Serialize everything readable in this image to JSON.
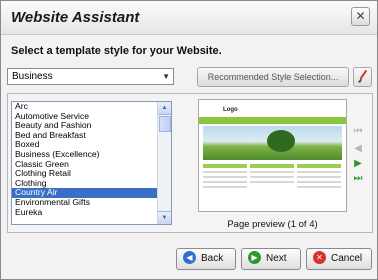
{
  "window": {
    "title": "Website Assistant",
    "close_glyph": "✕"
  },
  "heading": "Select a template style for your Website.",
  "category_select": {
    "value": "Business",
    "arrow": "▼"
  },
  "recommended_button": {
    "label": "Recommended Style Selection..."
  },
  "brush_button": {
    "icon": "paintbrush-icon"
  },
  "template_list": {
    "items": [
      "Arc",
      "Automotive Service",
      "Beauty and Fashion",
      "Bed and Breakfast",
      "Boxed",
      "Business (Excellence)",
      "Classic Green",
      "Clothing Retail",
      "Clothing",
      "Country Air",
      "Environmental Gifts",
      "Eureka"
    ],
    "selected": "Country Air",
    "scroll_up": "▲",
    "scroll_down": "▼"
  },
  "preview": {
    "logo_text": "Logo",
    "caption": "Page preview (1 of 4)"
  },
  "preview_nav": {
    "first": "⏮",
    "prev": "◀",
    "next": "▶",
    "last": "⏭"
  },
  "colors": {
    "accent_green": "#8cc63f",
    "selection_blue": "#3a6fc4",
    "back_icon_blue": "#2f6fd1",
    "next_icon_green": "#2e9a2e",
    "cancel_icon_red": "#d9322b"
  },
  "buttons": {
    "back": {
      "label": "Back",
      "glyph": "◀"
    },
    "next": {
      "label": "Next",
      "glyph": "▶"
    },
    "cancel": {
      "label": "Cancel",
      "glyph": "✕"
    }
  }
}
